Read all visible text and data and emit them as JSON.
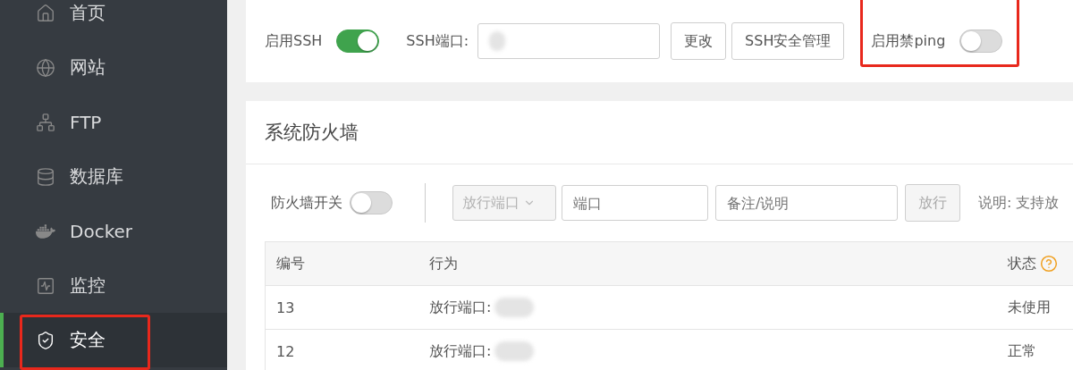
{
  "sidebar": {
    "items": [
      {
        "label": "首页",
        "selected": false,
        "highlighted": false
      },
      {
        "label": "网站",
        "selected": false,
        "highlighted": false
      },
      {
        "label": "FTP",
        "selected": false,
        "highlighted": false
      },
      {
        "label": "数据库",
        "selected": false,
        "highlighted": false
      },
      {
        "label": "Docker",
        "selected": false,
        "highlighted": false
      },
      {
        "label": "监控",
        "selected": false,
        "highlighted": false
      },
      {
        "label": "安全",
        "selected": true,
        "highlighted": true
      }
    ]
  },
  "ssh_bar": {
    "ssh_switch": {
      "label": "启用SSH",
      "on": true
    },
    "ssh_port": {
      "label": "SSH端口:",
      "redacted": true
    },
    "change_button": "更改",
    "manage_button": "SSH安全管理",
    "ping_switch": {
      "label": "启用禁ping",
      "on": false,
      "highlighted": true
    }
  },
  "firewall": {
    "title": "系统防火墙",
    "switch": {
      "label": "防火墙开关",
      "on": false
    },
    "policy_select": {
      "value": "放行端口",
      "disabled": true
    },
    "port_field": {
      "placeholder": "端口"
    },
    "note_field": {
      "placeholder": "备注/说明"
    },
    "allow_button": {
      "label": "放行",
      "disabled": true
    },
    "hint": "说明: 支持放",
    "table": {
      "columns": [
        {
          "label": "编号",
          "help": false
        },
        {
          "label": "行为",
          "help": false
        },
        {
          "label": "状态",
          "help": true
        }
      ],
      "rows": [
        {
          "cells": [
            "13",
            "放行端口:",
            "未使用"
          ],
          "redacted": true
        },
        {
          "cells": [
            "12",
            "放行端口:",
            "正常"
          ],
          "redacted": true
        }
      ]
    }
  }
}
